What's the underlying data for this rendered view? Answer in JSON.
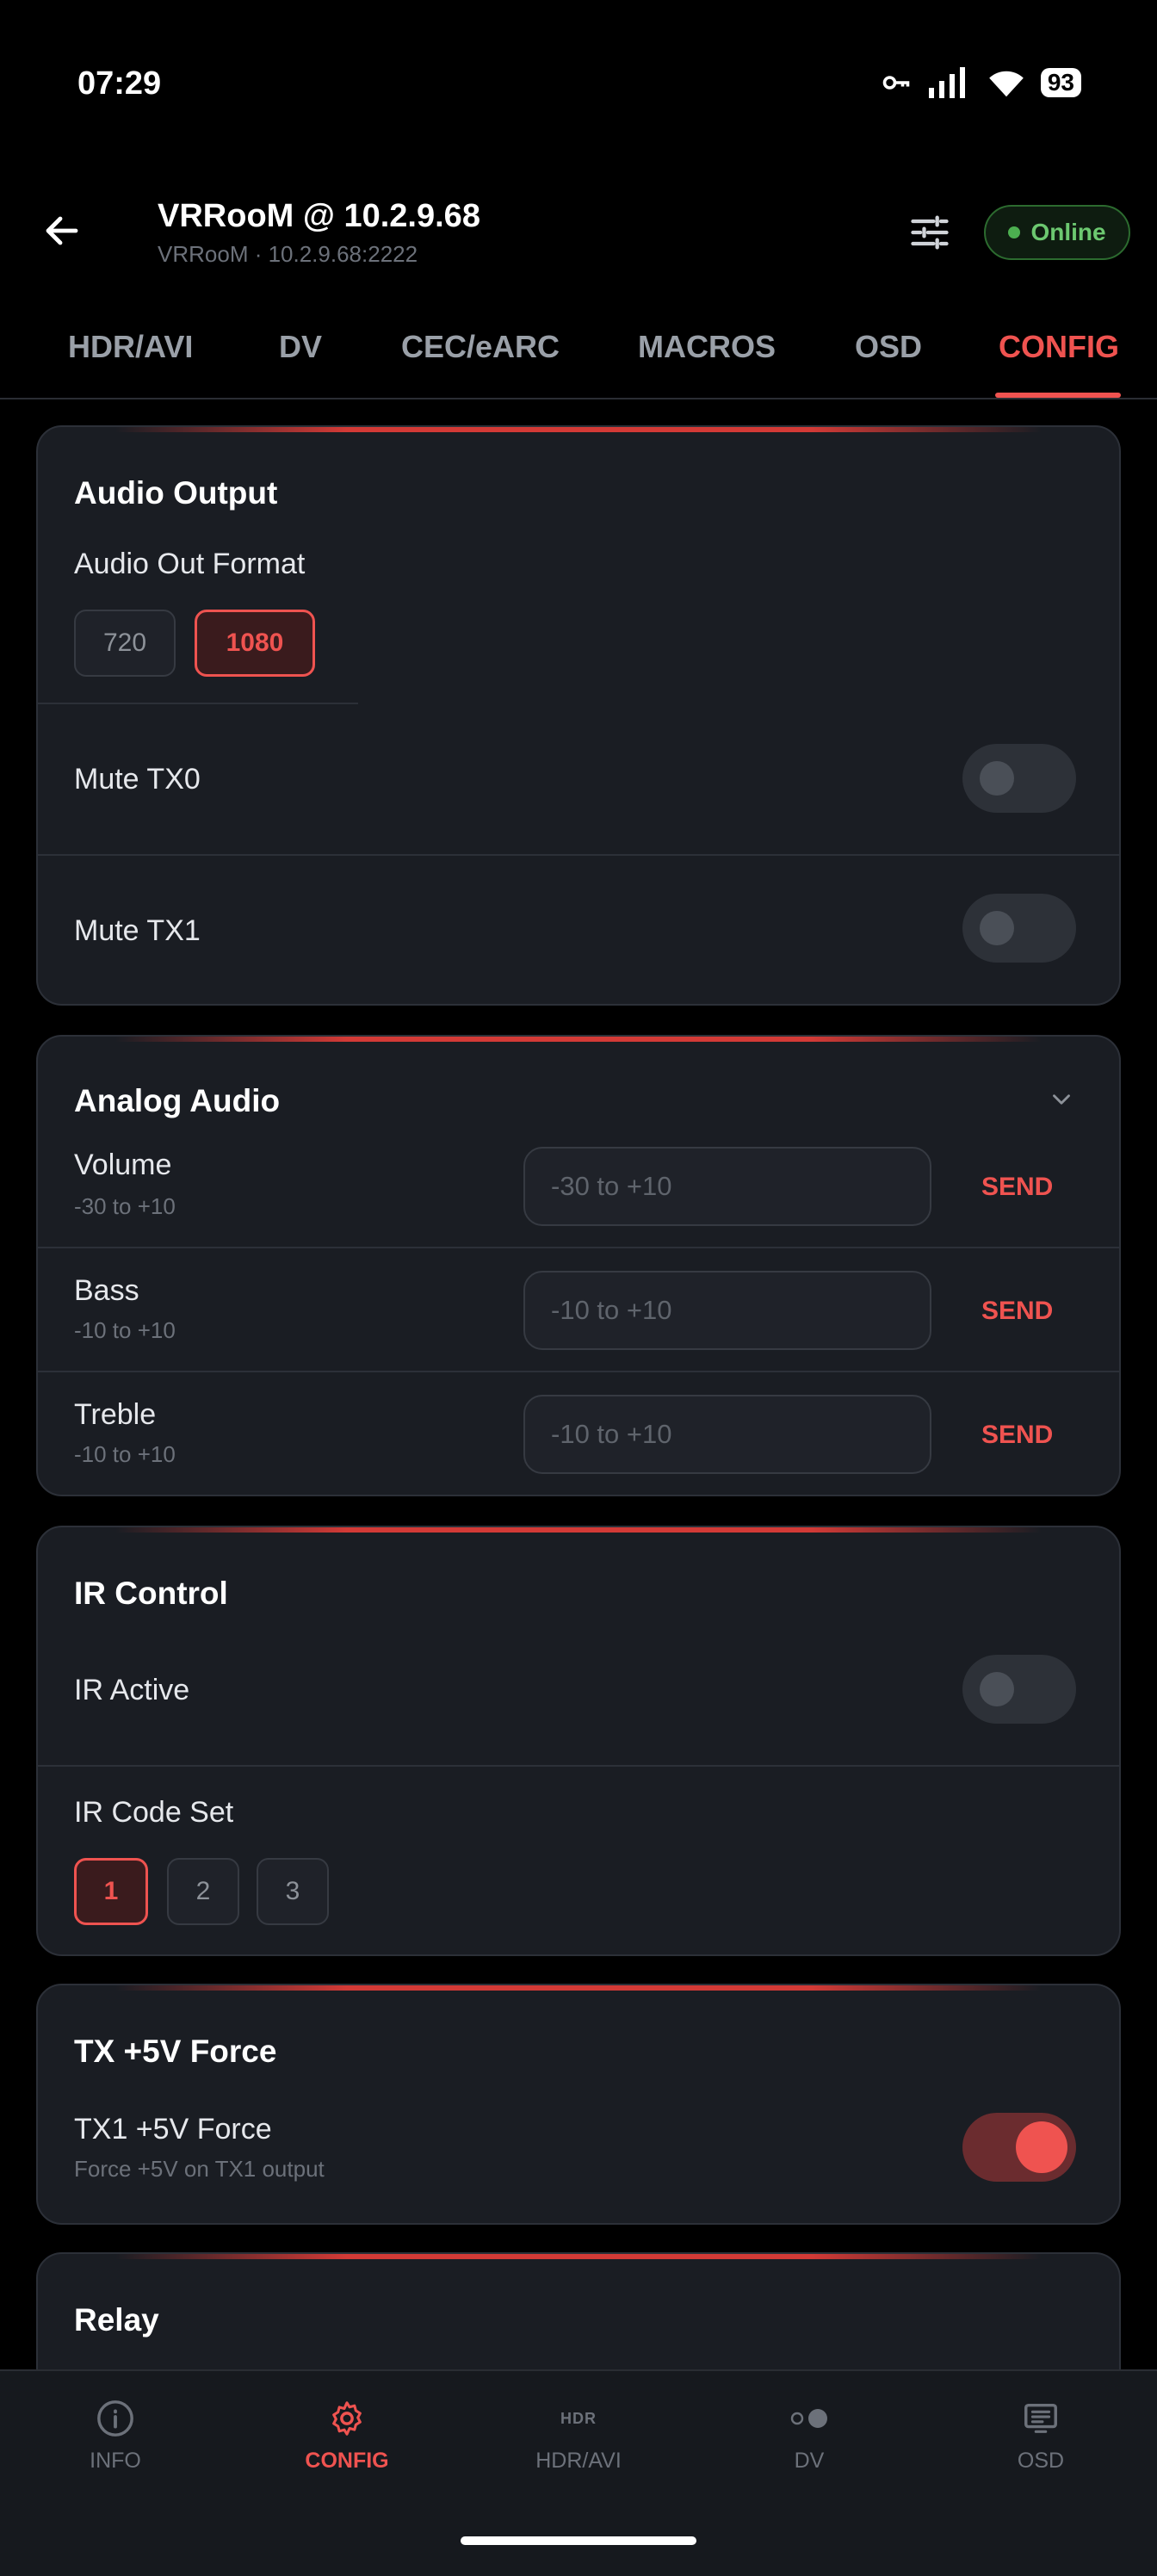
{
  "status_bar": {
    "time": "07:29",
    "battery": "93"
  },
  "header": {
    "title": "VRRooM @ 10.2.9.68",
    "subtitle": "VRRooM · 10.2.9.68:2222",
    "status": "Online"
  },
  "tabs": [
    {
      "label": "HDR/AVI"
    },
    {
      "label": "DV"
    },
    {
      "label": "CEC/eARC"
    },
    {
      "label": "MACROS"
    },
    {
      "label": "OSD"
    },
    {
      "label": "CONFIG",
      "active": true
    }
  ],
  "audio_output": {
    "title": "Audio Output",
    "format_label": "Audio Out Format",
    "formats": [
      "720",
      "1080"
    ],
    "selected_format": "1080",
    "mute_tx0_label": "Mute TX0",
    "mute_tx0": false,
    "mute_tx1_label": "Mute TX1",
    "mute_tx1": false
  },
  "analog_audio": {
    "title": "Analog Audio",
    "rows": [
      {
        "label": "Volume",
        "range": "-30 to +10",
        "placeholder": "-30 to +10",
        "action": "SEND"
      },
      {
        "label": "Bass",
        "range": "-10 to +10",
        "placeholder": "-10 to +10",
        "action": "SEND"
      },
      {
        "label": "Treble",
        "range": "-10 to +10",
        "placeholder": "-10 to +10",
        "action": "SEND"
      }
    ]
  },
  "ir_control": {
    "title": "IR Control",
    "active_label": "IR Active",
    "active": false,
    "code_set_label": "IR Code Set",
    "code_sets": [
      "1",
      "2",
      "3"
    ],
    "selected_code_set": "1"
  },
  "tx_force": {
    "title": "TX +5V Force",
    "label": "TX1 +5V Force",
    "description": "Force +5V on TX1 output",
    "enabled": true
  },
  "relay": {
    "title": "Relay"
  },
  "bottom_nav": [
    {
      "label": "INFO",
      "icon": "info-icon"
    },
    {
      "label": "CONFIG",
      "icon": "gear-icon",
      "active": true
    },
    {
      "label": "HDR/AVI",
      "icon": "hdr-icon",
      "icon_text": "HDR"
    },
    {
      "label": "DV",
      "icon": "toggle-dots-icon"
    },
    {
      "label": "OSD",
      "icon": "osd-icon"
    }
  ],
  "colors": {
    "accent": "#ef5350",
    "online": "#4caf50",
    "card": "#1a1d23",
    "background": "#000000"
  }
}
